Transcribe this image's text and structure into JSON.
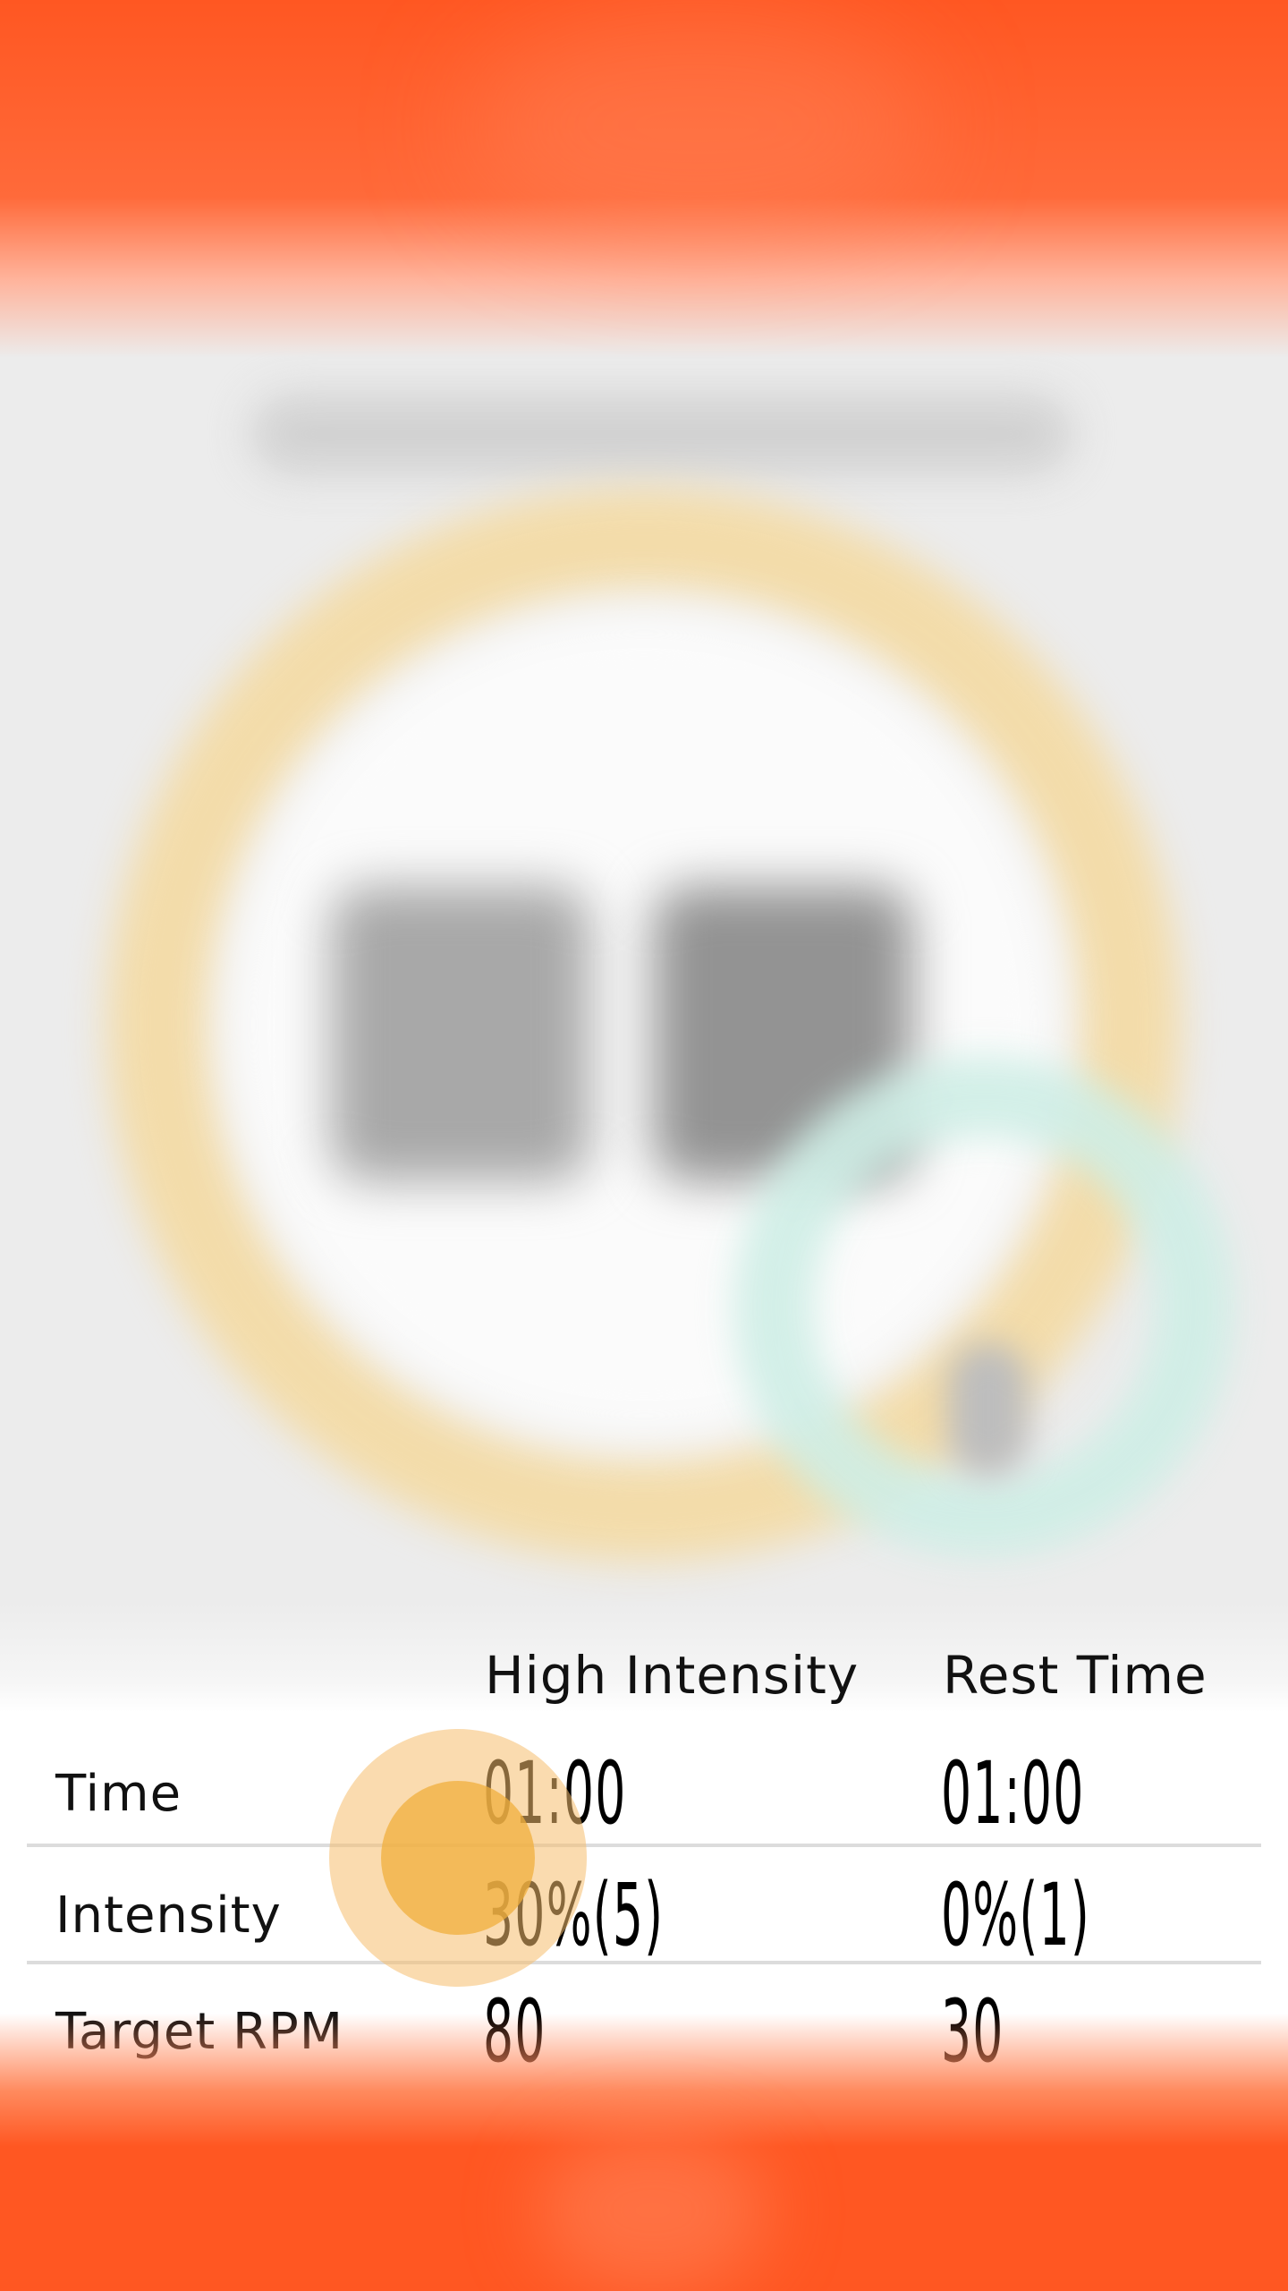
{
  "table": {
    "headers": [
      "High Intensity",
      "Rest Time"
    ],
    "rows": [
      {
        "label": "Time",
        "high": "01:00",
        "rest": "01:00"
      },
      {
        "label": "Intensity",
        "high": "30%(5)",
        "rest": "0%(1)"
      },
      {
        "label": "Target RPM",
        "high": "80",
        "rest": "30"
      }
    ]
  },
  "colors": {
    "accent": "#ff5722",
    "ring": "#f3dcaa",
    "secondary_ring": "#cfeee6",
    "touch": "#f0af3c"
  }
}
